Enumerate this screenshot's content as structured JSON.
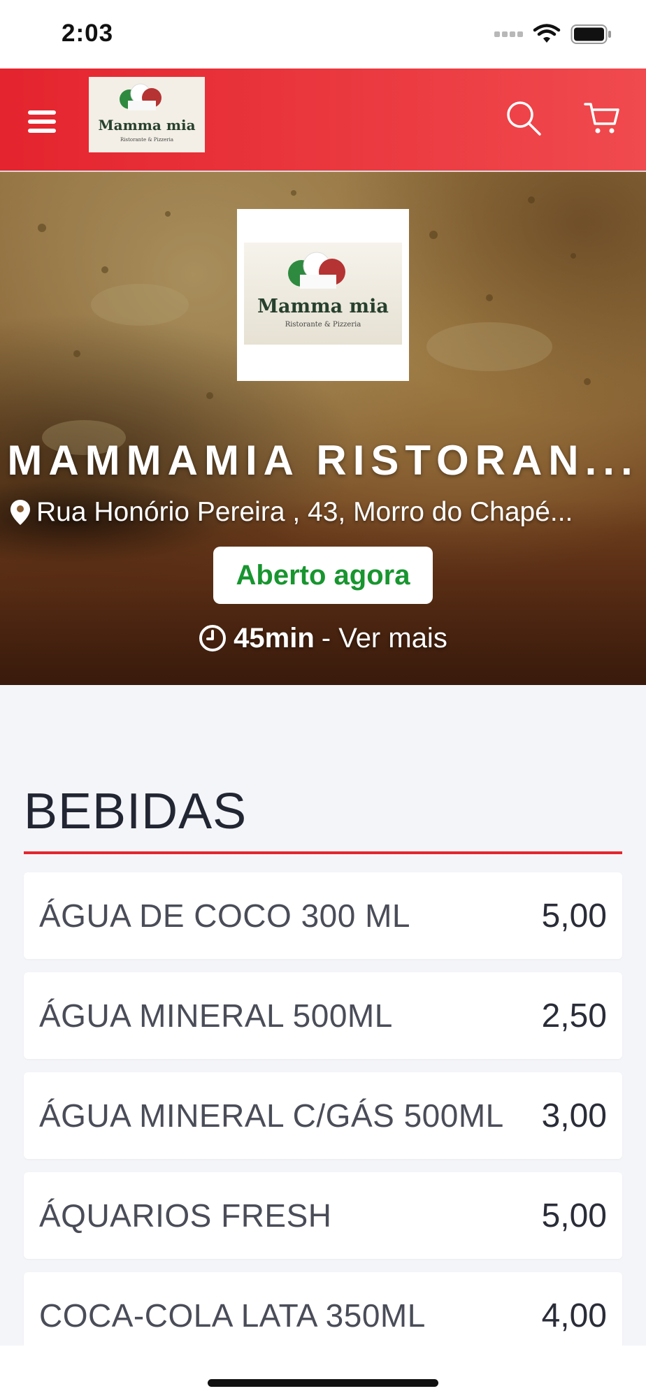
{
  "status_bar": {
    "time": "2:03"
  },
  "header": {
    "logo": {
      "brand": "Mamma mia",
      "tagline": "Ristorante & Pizzeria"
    },
    "icons": {
      "menu": "hamburger-menu-icon",
      "search": "search-icon",
      "cart": "cart-icon"
    }
  },
  "hero": {
    "name": "MAMMAMIA RISTORAN...",
    "address": "Rua Honório Pereira , 43, Morro do Chapé...",
    "status": "Aberto agora",
    "delivery_time": "45min",
    "see_more": "- Ver mais"
  },
  "menu": {
    "section_title": "BEBIDAS",
    "items": [
      {
        "name": "ÁGUA DE COCO 300 ML",
        "price": "5,00"
      },
      {
        "name": "ÁGUA MINERAL 500ML",
        "price": "2,50"
      },
      {
        "name": "ÁGUA MINERAL C/GÁS 500ML",
        "price": "3,00"
      },
      {
        "name": "ÁQUARIOS FRESH",
        "price": "5,00"
      },
      {
        "name": "COCA-COLA LATA 350ML",
        "price": "4,00"
      }
    ]
  },
  "colors": {
    "header_start": "#e4242e",
    "header_end": "#f04a4e",
    "accent": "#e4262f",
    "status_open": "#18952f",
    "page_bg": "#f4f5f9"
  }
}
